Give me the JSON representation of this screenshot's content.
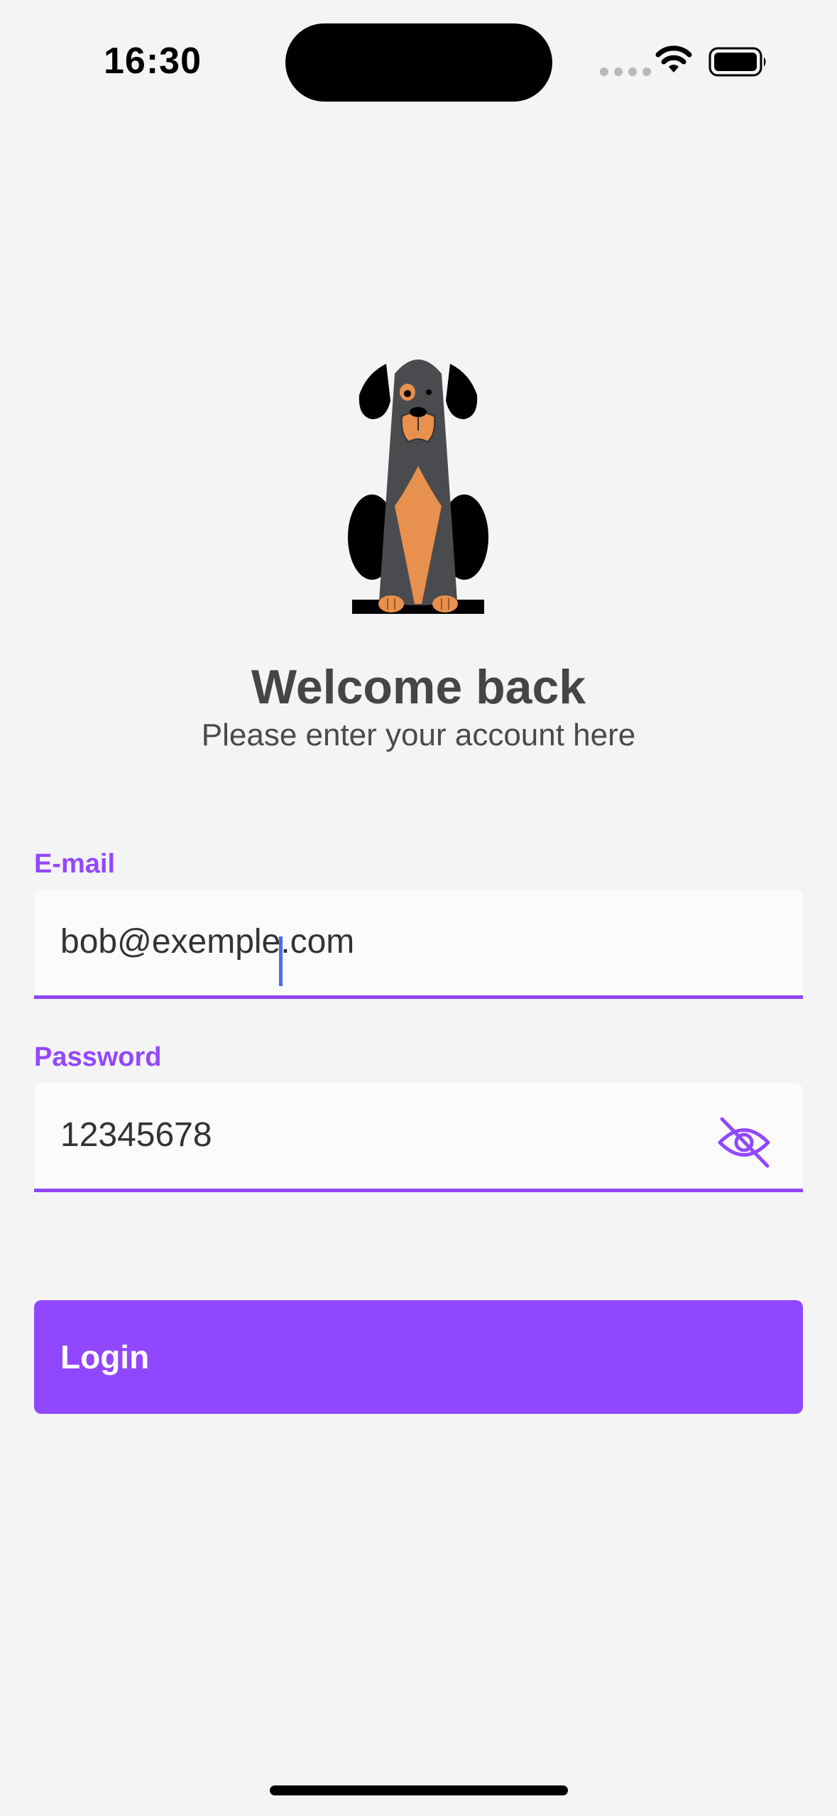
{
  "status_bar": {
    "time": "16:30"
  },
  "welcome": {
    "title": "Welcome back",
    "subtitle": "Please enter your account here"
  },
  "form": {
    "email": {
      "label": "E-mail",
      "value": "bob@exemple.com"
    },
    "password": {
      "label": "Password",
      "value": "12345678",
      "visibility_icon": "eye-off-icon"
    }
  },
  "actions": {
    "login_label": "Login"
  },
  "colors": {
    "accent": "#9147ff",
    "background": "#f4f4f4",
    "text": "#454545"
  }
}
